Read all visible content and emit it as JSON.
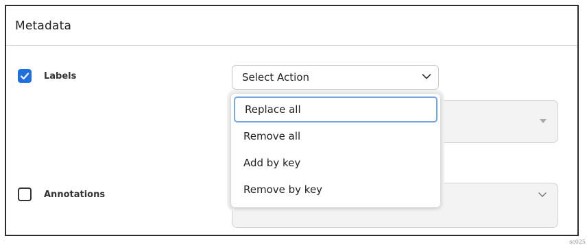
{
  "panel": {
    "title": "Metadata"
  },
  "labels_row": {
    "label": "Labels",
    "checked": true
  },
  "annotations_row": {
    "label": "Annotations",
    "checked": false
  },
  "select": {
    "value": "Select Action"
  },
  "dropdown": {
    "options": [
      "Replace all",
      "Remove all",
      "Add by key",
      "Remove by key"
    ],
    "active_index": 0
  },
  "corner_note": "sc025",
  "colors": {
    "accent": "#1f6fdc",
    "focus_border": "#7aa6de",
    "disabled_bg": "#f3f3f3"
  }
}
